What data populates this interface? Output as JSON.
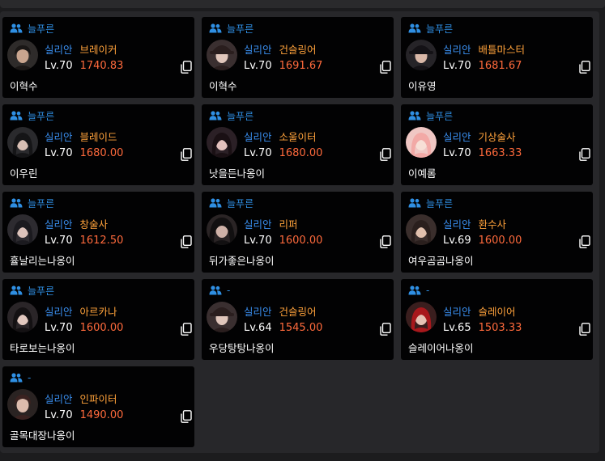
{
  "cards": [
    {
      "guild": "늘푸른",
      "server": "실리안",
      "class_name": "브레이커",
      "level": "Lv.70",
      "item_level": "1740.83",
      "character": "이혁수",
      "avatar": {
        "bg": "#2e2b2a",
        "face": "#c9a58f",
        "hair": "#1a1716",
        "style": "short"
      }
    },
    {
      "guild": "늘푸른",
      "server": "실리안",
      "class_name": "건슬링어",
      "level": "Lv.70",
      "item_level": "1691.67",
      "character": "이혁수",
      "avatar": {
        "bg": "#3a2f30",
        "face": "#e0c6bb",
        "hair": "#2a1e1e",
        "style": "hat"
      }
    },
    {
      "guild": "늘푸른",
      "server": "실리안",
      "class_name": "배틀마스터",
      "level": "Lv.70",
      "item_level": "1681.67",
      "character": "이유영",
      "avatar": {
        "bg": "#262428",
        "face": "#d9b8a8",
        "hair": "#141216",
        "style": "hat"
      }
    },
    {
      "guild": "늘푸른",
      "server": "실리안",
      "class_name": "블레이드",
      "level": "Lv.70",
      "item_level": "1680.00",
      "character": "이우린",
      "avatar": {
        "bg": "#2a2a2d",
        "face": "#d8bfb4",
        "hair": "#151517",
        "style": "long"
      }
    },
    {
      "guild": "늘푸른",
      "server": "실리안",
      "class_name": "소울이터",
      "level": "Lv.70",
      "item_level": "1680.00",
      "character": "낫을든나옹이",
      "avatar": {
        "bg": "#2b2026",
        "face": "#e3c1bd",
        "hair": "#1a1014",
        "style": "long"
      }
    },
    {
      "guild": "늘푸른",
      "server": "실리안",
      "class_name": "기상술사",
      "level": "Lv.70",
      "item_level": "1663.33",
      "character": "이예롬",
      "avatar": {
        "bg": "#f0c7c4",
        "face": "#f7dfd6",
        "hair": "#f2a9a6",
        "style": "long"
      }
    },
    {
      "guild": "늘푸른",
      "server": "실리안",
      "class_name": "창술사",
      "level": "Lv.70",
      "item_level": "1612.50",
      "character": "휼날리는나옹이",
      "avatar": {
        "bg": "#2d2b30",
        "face": "#dcc3bb",
        "hair": "#1b1a1f",
        "style": "long"
      }
    },
    {
      "guild": "늘푸른",
      "server": "실리안",
      "class_name": "리퍼",
      "level": "Lv.70",
      "item_level": "1600.00",
      "character": "뒤가좋은나옹이",
      "avatar": {
        "bg": "#2a2425",
        "face": "#cfb2a8",
        "hair": "#121011",
        "style": "hood"
      }
    },
    {
      "guild": "늘푸른",
      "server": "실리안",
      "class_name": "환수사",
      "level": "Lv.69",
      "item_level": "1600.00",
      "character": "여우곰곰나옹이",
      "avatar": {
        "bg": "#3a2e2c",
        "face": "#e1c0ad",
        "hair": "#2a1f1d",
        "style": "long"
      }
    },
    {
      "guild": "늘푸른",
      "server": "실리안",
      "class_name": "아르카나",
      "level": "Lv.70",
      "item_level": "1600.00",
      "character": "타로보는나옹이",
      "avatar": {
        "bg": "#2a2528",
        "face": "#e2c8bf",
        "hair": "#141113",
        "style": "long"
      }
    },
    {
      "guild": "-",
      "server": "실리안",
      "class_name": "건슬링어",
      "level": "Lv.64",
      "item_level": "1545.00",
      "character": "우당탕탕나옹이",
      "avatar": {
        "bg": "#3a2f30",
        "face": "#e0c6bb",
        "hair": "#2a1e1e",
        "style": "hat"
      }
    },
    {
      "guild": "-",
      "server": "실리안",
      "class_name": "슬레이어",
      "level": "Lv.65",
      "item_level": "1503.33",
      "character": "슬레이어나옹이",
      "avatar": {
        "bg": "#3a1e1e",
        "face": "#e6c2b4",
        "hair": "#a8181c",
        "style": "long"
      }
    },
    {
      "guild": "-",
      "server": "실리안",
      "class_name": "인파이터",
      "level": "Lv.70",
      "item_level": "1490.00",
      "character": "골목대장나옹이",
      "avatar": {
        "bg": "#2a2322",
        "face": "#dcbcad",
        "hair": "#3a2220",
        "style": "short"
      }
    }
  ],
  "icons": {
    "guild": "users-icon",
    "copy": "copy-icon"
  },
  "colors": {
    "guild": "#2f8fe3",
    "server": "#3a8ff0",
    "class": "#ffa23b",
    "item_level": "#ff6a3c",
    "card_bg": "#020203",
    "panel_bg": "#27272a"
  }
}
